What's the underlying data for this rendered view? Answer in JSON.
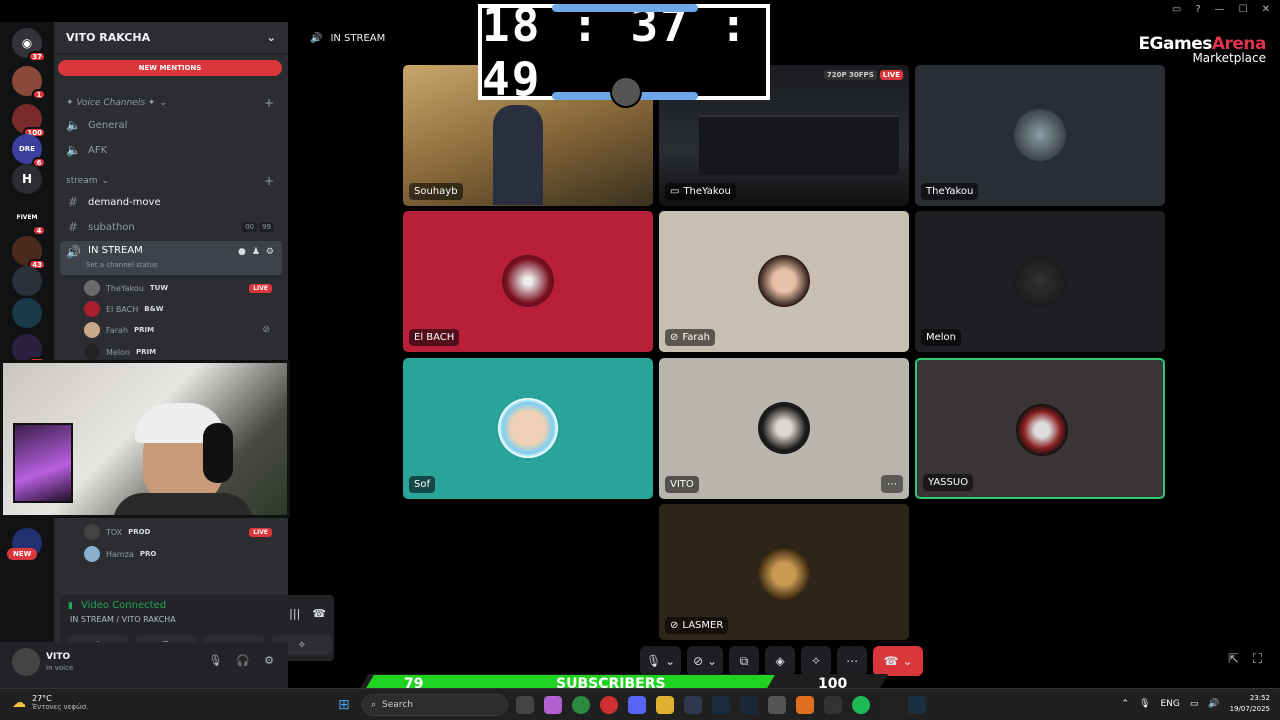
{
  "server": {
    "name": "VITO RAKCHA",
    "new_mentions": "NEW MENTIONS"
  },
  "rail": {
    "badges": [
      "37",
      "1",
      "100",
      "6",
      "4",
      "43",
      "17"
    ],
    "letters": {
      "h": "H",
      "fivem": "FIVEM",
      "dre": "DRE"
    },
    "new": "NEW"
  },
  "categories": {
    "voice": "✦ Voice Channels ✦",
    "stream": "stream"
  },
  "channels": {
    "general": "General",
    "afk": "AFK",
    "demand_move": "demand-move",
    "subathon": "subathon",
    "subathon_count_a": "00",
    "subathon_count_b": "99",
    "in_stream": "IN STREAM",
    "set_status": "Set a channel status"
  },
  "members": [
    {
      "name": "TheYakou",
      "tag": "TUW",
      "live": "LIVE"
    },
    {
      "name": "El BACH",
      "tag": "B&W"
    },
    {
      "name": "Farah",
      "tag": "PRIM"
    },
    {
      "name": "Melon",
      "tag": "PRIM"
    },
    {
      "name": "TOX",
      "tag": "PROD",
      "live": "LIVE"
    },
    {
      "name": "Hamza",
      "tag": "PRO"
    }
  ],
  "voice_panel": {
    "status": "Video Connected",
    "channel": "IN STREAM / VITO RAKCHA"
  },
  "user": {
    "name": "VITO",
    "status": "In voice"
  },
  "header": {
    "channel": "IN STREAM"
  },
  "tiles": [
    {
      "name": "Souhayb"
    },
    {
      "name": "TheYakou",
      "quality": "720P 30FPS",
      "live": "LIVE"
    },
    {
      "name": "TheYakou"
    },
    {
      "name": "El BACH"
    },
    {
      "name": "Farah"
    },
    {
      "name": "Melon"
    },
    {
      "name": "Sof"
    },
    {
      "name": "VITO"
    },
    {
      "name": "YASSUO"
    },
    {
      "name": "LASMER"
    }
  ],
  "clock": {
    "time": "18 : 37 : 49"
  },
  "logo": {
    "line1_a": "EGames",
    "line1_b": "Arena",
    "line2": "Marketplace"
  },
  "subscribers": {
    "current": "79",
    "label": "SUBSCRIBERS",
    "goal": "100",
    "progress": 0.79
  },
  "taskbar": {
    "temp": "27°C",
    "weather": "Έντονες νεφώσ.",
    "search_placeholder": "Search",
    "lang": "ENG",
    "time": "23:52",
    "date": "19/07/2025"
  },
  "colors": {
    "accent_red": "#da373c",
    "voice_green": "#23a55a",
    "sub_green": "#21d321",
    "clock_bar": "#6ea8e8"
  }
}
